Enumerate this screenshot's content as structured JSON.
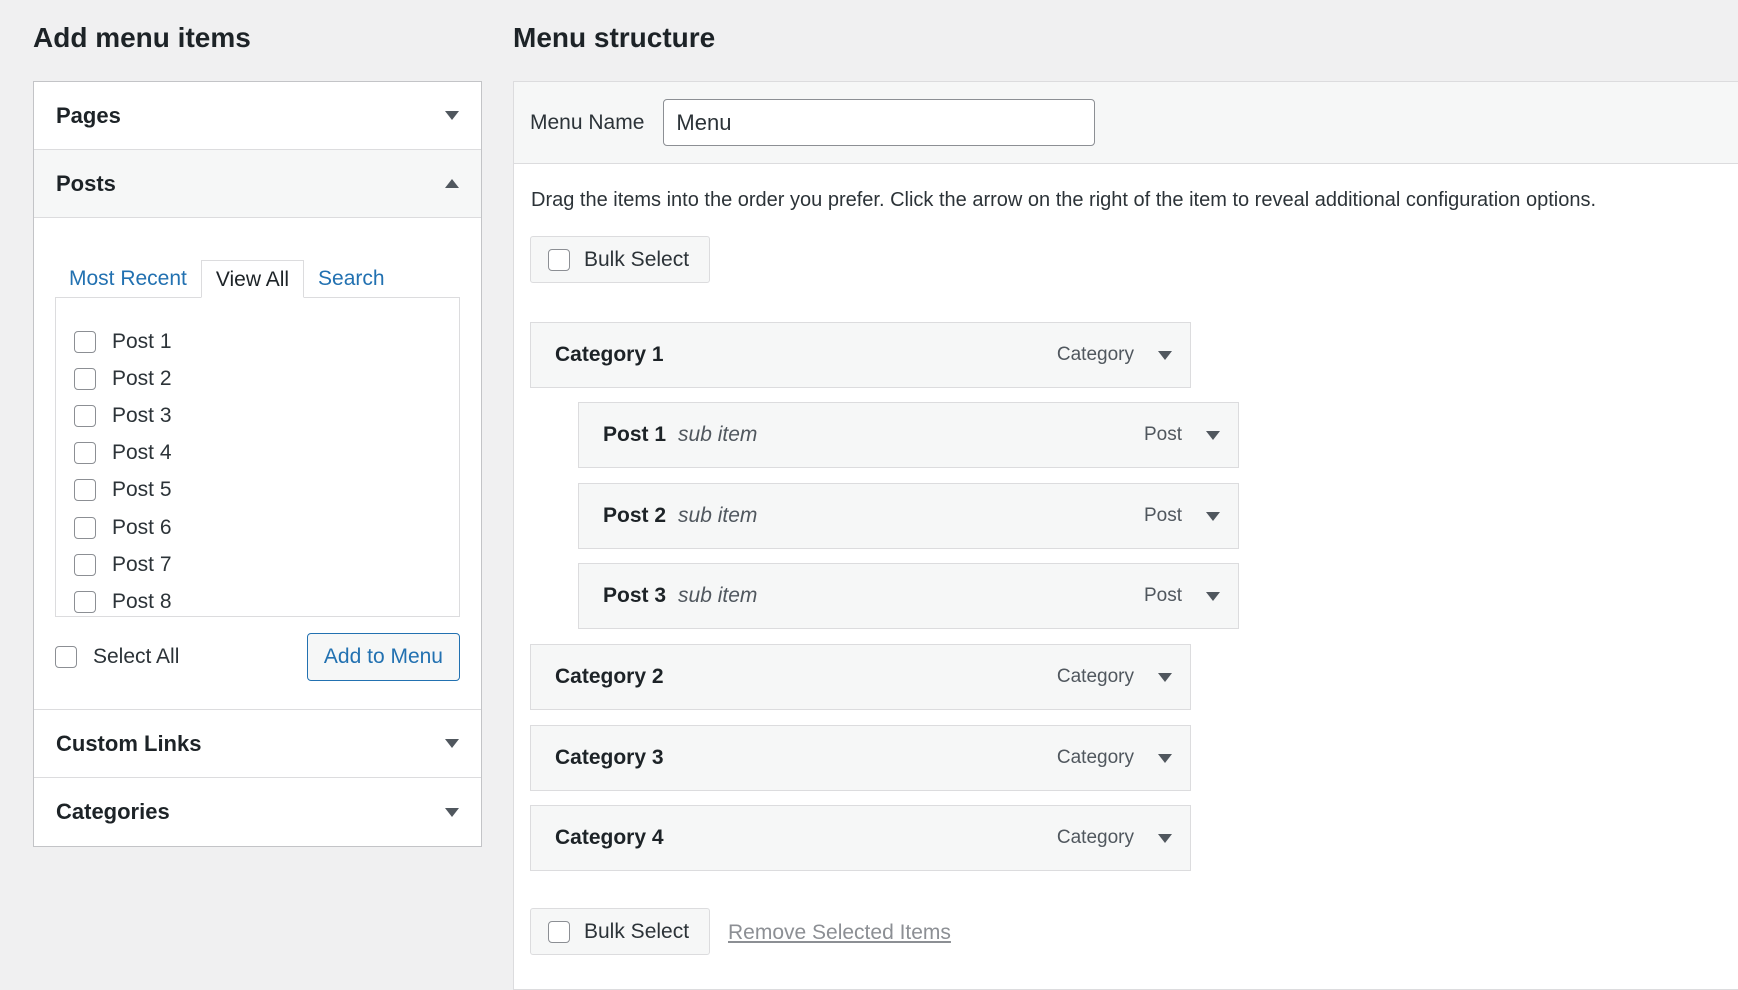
{
  "left": {
    "heading": "Add menu items",
    "sections": {
      "pages": "Pages",
      "posts": "Posts",
      "custom_links": "Custom Links",
      "categories": "Categories"
    },
    "tabs": [
      "Most Recent",
      "View All",
      "Search"
    ],
    "active_tab": "View All",
    "posts": [
      "Post 1",
      "Post 2",
      "Post 3",
      "Post 4",
      "Post 5",
      "Post 6",
      "Post 7",
      "Post 8"
    ],
    "select_all_label": "Select All",
    "add_button": "Add to Menu"
  },
  "right": {
    "heading": "Menu structure",
    "menu_name_label": "Menu Name",
    "menu_name_value": "Menu",
    "instructions": "Drag the items into the order you prefer. Click the arrow on the right of the item to reveal additional configuration options.",
    "bulk_select_label": "Bulk Select",
    "remove_selected_label": "Remove Selected Items",
    "items": [
      {
        "title": "Category 1",
        "sub": "",
        "type": "Category"
      },
      {
        "title": "Post 1",
        "sub": "sub item",
        "type": "Post"
      },
      {
        "title": "Post 2",
        "sub": "sub item",
        "type": "Post"
      },
      {
        "title": "Post 3",
        "sub": "sub item",
        "type": "Post"
      },
      {
        "title": "Category 2",
        "sub": "",
        "type": "Category"
      },
      {
        "title": "Category 3",
        "sub": "",
        "type": "Category"
      },
      {
        "title": "Category 4",
        "sub": "",
        "type": "Category"
      }
    ]
  },
  "colors": {
    "link": "#2271b1",
    "background": "#f0f0f1",
    "panel": "#ffffff",
    "border": "#dcdcde"
  }
}
